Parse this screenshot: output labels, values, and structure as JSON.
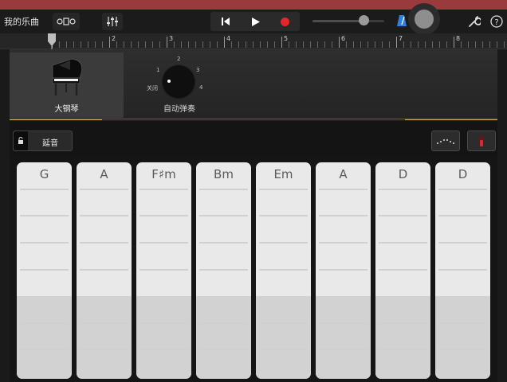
{
  "toolbar": {
    "my_songs_label": "我的乐曲",
    "icons": {
      "tracks": "tracks-view-icon",
      "mixer": "mixer-icon",
      "rewind": "go-to-start-icon",
      "play": "play-icon",
      "record": "record-icon",
      "metronome": "metronome-icon",
      "settings": "wrench-icon",
      "help": "help-icon"
    },
    "volume_level": 0.7
  },
  "ruler": {
    "measures": [
      "2",
      "3",
      "4",
      "5",
      "6",
      "7",
      "8"
    ]
  },
  "instrument": {
    "name": "大钢琴",
    "icon": "grand-piano-icon"
  },
  "autoplay": {
    "caption": "自动弹奏",
    "off_label": "关闭",
    "positions": [
      "1",
      "2",
      "3",
      "4"
    ]
  },
  "controls": {
    "sustain_label": "延音",
    "arpeggio_icon": "arpeggio-icon",
    "settings_icon": "chord-settings-icon"
  },
  "chords": [
    "G",
    "A",
    "F♯m",
    "Bm",
    "Em",
    "A",
    "D",
    "D"
  ],
  "colors": {
    "status_strip": "#9b3a3c",
    "accent_gold": "#c9a64b",
    "record_red": "#e5242b",
    "metronome_blue": "#2f7fe0",
    "chord_strip": "#e9e9e9"
  }
}
